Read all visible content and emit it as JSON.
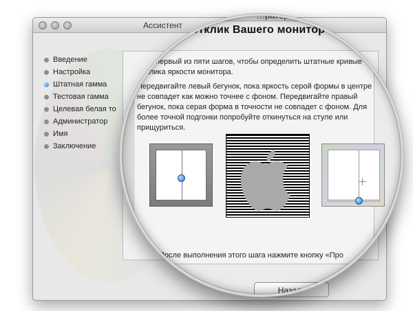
{
  "window": {
    "title_visible": "Ассистент",
    "title_magnified": "…ратора монитора",
    "traffic_lights": [
      "close-button",
      "minimize-button",
      "zoom-button"
    ]
  },
  "sidebar": {
    "items": [
      {
        "label": "Введение",
        "active": false
      },
      {
        "label": "Настройка",
        "active": false
      },
      {
        "label": "Штатная гамма",
        "active": true
      },
      {
        "label": "Тестовая гамма",
        "active": false
      },
      {
        "label": "Целевая белая то",
        "active": false
      },
      {
        "label": "Администратор",
        "active": false
      },
      {
        "label": "Имя",
        "active": false
      },
      {
        "label": "Заключение",
        "active": false
      }
    ]
  },
  "main": {
    "heading": "…тный отклик Вашего монитор",
    "intro": "…то первый из пяти шагов, чтобы определить штатные кривые отклика яркости монитора.",
    "instructions": "Передвигайте левый бегунок, пока яркость серой формы в центре не совпадет как можно точнее с фоном. Передвигайте правый бегунок, пока серая форма в точности не совпадет с фоном. Для более точной подгонки попробуйте откинуться на стуле или прищуриться.",
    "footer": "После выполнения этого шага нажмите кнопку «Про"
  },
  "controls": {
    "left_slider": {
      "value": 0.5
    },
    "right_slider": {
      "value": 0.5,
      "height": 0.08
    }
  },
  "buttons": {
    "back_label": "Назад"
  },
  "colors": {
    "accent_blue": "#2b73cf",
    "window_bg": "#e8e8e8"
  }
}
